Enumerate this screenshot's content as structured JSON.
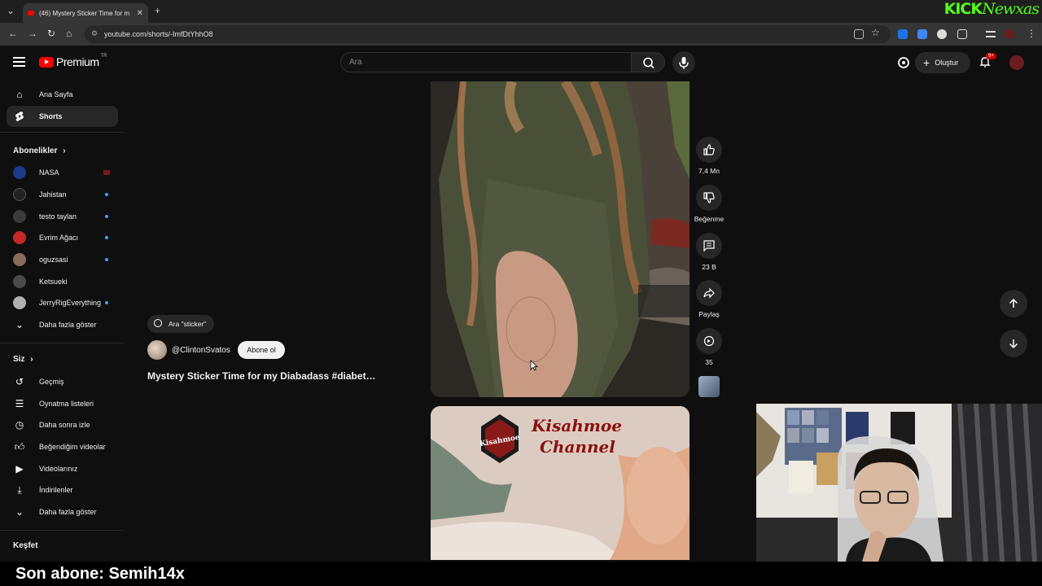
{
  "browser": {
    "tab_title": "(46) Mystery Sticker Time for m",
    "url": "youtube.com/shorts/-ImfDtYhhO8",
    "overlay_brand": "KICK",
    "overlay_brand_script": "Newxas"
  },
  "header": {
    "logo_text": "Premium",
    "country_code": "TR",
    "search_placeholder": "Ara",
    "create_label": "Oluştur",
    "notif_badge": "9+"
  },
  "sidebar": {
    "main": [
      {
        "label": "Ana Sayfa",
        "icon": "home-icon"
      },
      {
        "label": "Shorts",
        "icon": "shorts-icon",
        "active": true
      }
    ],
    "subscriptions_title": "Abonelikler",
    "subscriptions": [
      {
        "label": "NASA",
        "color": "#1e3a8a"
      },
      {
        "label": "Jahistan",
        "color": "#222222"
      },
      {
        "label": "testo taylan",
        "color": "#3a3a3a"
      },
      {
        "label": "Evrim Ağacı",
        "color": "#c62828"
      },
      {
        "label": "oguzsasi",
        "color": "#8a6a5a"
      },
      {
        "label": "Ketsueki",
        "color": "#4a4a4a"
      },
      {
        "label": "JerryRigEverything",
        "color": "#b0b0b0"
      }
    ],
    "show_more_1": "Daha fazla göster",
    "you_title": "Siz",
    "you_items": [
      {
        "label": "Geçmiş",
        "icon": "history-icon"
      },
      {
        "label": "Oynatma listeleri",
        "icon": "playlist-icon"
      },
      {
        "label": "Daha sonra izle",
        "icon": "clock-icon"
      },
      {
        "label": "Beğendiğim videolar",
        "icon": "thumb-up-icon"
      },
      {
        "label": "Videolarınız",
        "icon": "video-icon"
      },
      {
        "label": "İndirilenler",
        "icon": "download-icon"
      }
    ],
    "show_more_2": "Daha fazla göster",
    "explore_title": "Keşfet"
  },
  "video": {
    "search_chip": "Ara \"sticker\"",
    "channel": "@ClintonSvatos",
    "subscribe_label": "Abone ol",
    "title": "Mystery Sticker Time for my Diabadass #diabet…",
    "likes": "7,4 Mn",
    "dislike_label": "Beğenme",
    "comments": "23 B",
    "share_label": "Paylaş",
    "remix_count": "35",
    "next_video_text_1": "Kisahmoe",
    "next_video_text_2": "Channel",
    "next_video_logo": "Kisahmoe"
  },
  "overlay": {
    "last_sub": "Son abone: Semih14x"
  }
}
